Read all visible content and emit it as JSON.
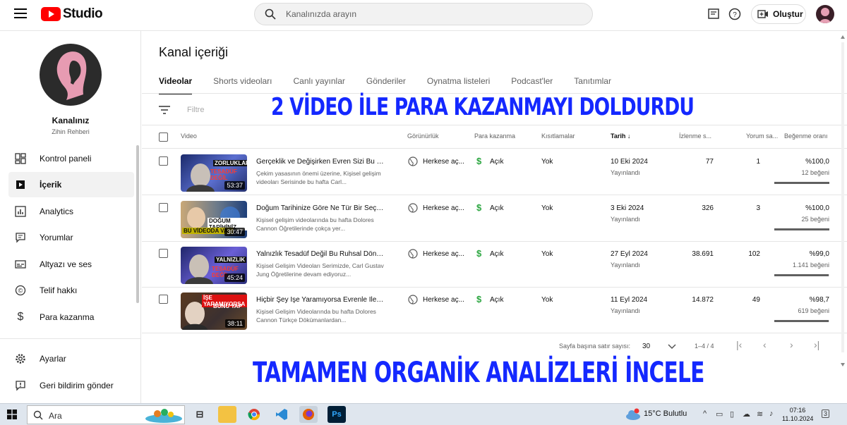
{
  "topbar": {
    "logo_text": "Studio",
    "search_placeholder": "Kanalınızda arayın",
    "create_label": "Oluştur"
  },
  "sidebar": {
    "channel_name": "Kanalınız",
    "channel_sub": "Zihin Rehberi",
    "items": [
      {
        "label": "Kontrol paneli",
        "icon": "dashboard-icon"
      },
      {
        "label": "İçerik",
        "icon": "content-icon",
        "active": true
      },
      {
        "label": "Analytics",
        "icon": "analytics-icon"
      },
      {
        "label": "Yorumlar",
        "icon": "comments-icon"
      },
      {
        "label": "Altyazı ve ses",
        "icon": "subtitles-icon"
      },
      {
        "label": "Telif hakkı",
        "icon": "copyright-icon"
      },
      {
        "label": "Para kazanma",
        "icon": "dollar-icon"
      }
    ],
    "bottom_items": [
      {
        "label": "Ayarlar",
        "icon": "gear-icon"
      },
      {
        "label": "Geri bildirim gönder",
        "icon": "feedback-icon"
      }
    ]
  },
  "main": {
    "title": "Kanal içeriği",
    "tabs": [
      "Videolar",
      "Shorts videoları",
      "Canlı yayınlar",
      "Gönderiler",
      "Oynatma listeleri",
      "Podcast'ler",
      "Tanıtımlar"
    ],
    "filter_placeholder": "Filtre",
    "columns": {
      "video": "Video",
      "visibility": "Görünürlük",
      "monetization": "Para kazanma",
      "restrictions": "Kısıtlamalar",
      "date": "Tarih",
      "views": "İzlenme s...",
      "comments": "Yorum sa...",
      "likes": "Beğenme oranı"
    },
    "rows": [
      {
        "title": "Gerçeklik ve Değişirken Evren Sizi Bu Ş...",
        "desc": "Çekim yasasının önemi üzerine, Kişisel gelişim videoları Serisinde bu hafta Carl...",
        "duration": "53:37",
        "thumb_caption": "ZORLUKLAR",
        "thumb_caption2": "TESADÜF DEĞİL",
        "visibility": "Herkese aç...",
        "monetization": "Açık",
        "restrictions": "Yok",
        "date": "10 Eki 2024",
        "date_status": "Yayınlandı",
        "views": "77",
        "comments": "1",
        "like_ratio": "%100,0",
        "likes": "12 beğeni",
        "like_fraction": 1.0
      },
      {
        "title": "Doğum Tarihinize Göre Ne Tür Bir Seçil...",
        "desc": "Kişisel gelişim videolarında bu hafta Dolores Cannon Öğretilerinde çokça yer...",
        "duration": "30:47",
        "thumb_caption": "DOĞUM TARİHİNİZ",
        "thumb_caption2": "BU VİDEODA VA...",
        "visibility": "Herkese aç...",
        "monetization": "Açık",
        "restrictions": "Yok",
        "date": "3 Eki 2024",
        "date_status": "Yayınlandı",
        "views": "326",
        "comments": "3",
        "like_ratio": "%100,0",
        "likes": "25 beğeni",
        "like_fraction": 1.0
      },
      {
        "title": "Yalnızlık Tesadüf Değil Bu Ruhsal Dönü...",
        "desc": "Kişisel Gelişim Videoları Serimizde, Carl Gustav Jung Öğretilerine devam ediyoruz...",
        "duration": "45:24",
        "thumb_caption": "YALNIZLIK",
        "thumb_caption2": "TESADÜF DEĞİL",
        "visibility": "Herkese aç...",
        "monetization": "Açık",
        "restrictions": "Yok",
        "date": "27 Eyl 2024",
        "date_status": "Yayınlandı",
        "views": "38.691",
        "comments": "102",
        "like_ratio": "%99,0",
        "likes": "1.141 beğeni",
        "like_fraction": 0.99
      },
      {
        "title": "Hiçbir Şey İşe Yaramıyorsa Evrenle İleti...",
        "desc": "Kişisel Gelişim Videolarında bu hafta Dolores Cannon Türkçe Dökümanlardan...",
        "duration": "38:11",
        "thumb_caption": "İŞE YARAMIYORSA",
        "thumb_caption2": "BUNU YAP",
        "visibility": "Herkese aç...",
        "monetization": "Açık",
        "restrictions": "Yok",
        "date": "11 Eyl 2024",
        "date_status": "Yayınlandı",
        "views": "14.872",
        "comments": "49",
        "like_ratio": "%98,7",
        "likes": "619 beğeni",
        "like_fraction": 0.987
      }
    ],
    "pager": {
      "rows_label": "Sayfa başına satır sayısı:",
      "rows_value": "30",
      "range": "1–4 / 4"
    }
  },
  "overlay": {
    "top_text": "2 VİDEO İLE PARA KAZANMAYI DOLDURDU",
    "bottom_text": "TAMAMEN ORGANİK ANALİZLERİ İNCELE",
    "color": "#1428ff"
  },
  "taskbar": {
    "search_label": "Ara",
    "weather": "15°C Bulutlu",
    "time": "07:16",
    "date": "11.10.2024",
    "apps": [
      "task-view",
      "file-explorer",
      "chrome",
      "vscode",
      "firefox",
      "photoshop"
    ]
  }
}
